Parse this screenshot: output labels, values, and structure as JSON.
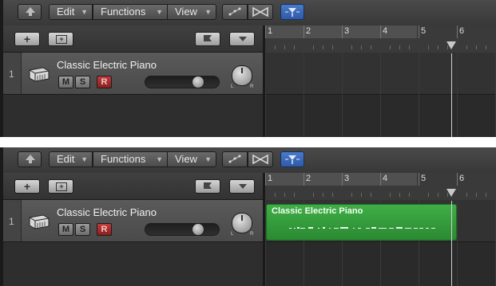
{
  "toolbar": {
    "menus": [
      {
        "label": "Edit"
      },
      {
        "label": "Functions"
      },
      {
        "label": "View"
      }
    ],
    "dropdown_arrow": "▼",
    "automation_icon": "automation-curve-icon",
    "flex_icon": "flex-pitch-icon",
    "catch_icon": "catch-playhead-icon",
    "catch_color": "#3a6bbf"
  },
  "track_header": {
    "add_label": "+"
  },
  "track": {
    "number": "1",
    "name": "Classic Electric Piano",
    "mute": "M",
    "solo": "S",
    "record": "R",
    "volume_level": 0.72,
    "pan_left": "L",
    "pan_right": "R",
    "record_color": "#b03030"
  },
  "ruler": {
    "bars": [
      "1",
      "2",
      "3",
      "4",
      "5",
      "6"
    ],
    "playhead_bar": 5.85
  },
  "region": {
    "name": "Classic Electric Piano",
    "color": "#37a33e",
    "start_bar": 1,
    "end_bar": 5.85
  },
  "panels": [
    {
      "state": "before",
      "has_region": false
    },
    {
      "state": "after",
      "has_region": true
    }
  ]
}
